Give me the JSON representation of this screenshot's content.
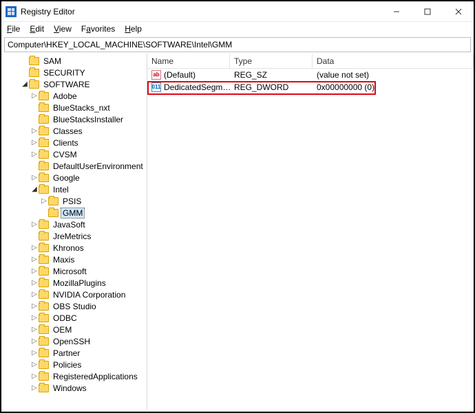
{
  "window": {
    "title": "Registry Editor"
  },
  "menu": {
    "file": "File",
    "edit": "Edit",
    "view": "View",
    "favorites": "Favorites",
    "help": "Help"
  },
  "path": "Computer\\HKEY_LOCAL_MACHINE\\SOFTWARE\\Intel\\GMM",
  "columns": {
    "name": "Name",
    "type": "Type",
    "data": "Data"
  },
  "values": [
    {
      "icon": "sz",
      "name": "(Default)",
      "type": "REG_SZ",
      "data": "(value not set)"
    },
    {
      "icon": "dw",
      "name": "DedicatedSegm…",
      "type": "REG_DWORD",
      "data": "0x00000000 (0)"
    }
  ],
  "tree": [
    {
      "indent": 2,
      "exp": "none",
      "label": "SAM"
    },
    {
      "indent": 2,
      "exp": "none",
      "label": "SECURITY"
    },
    {
      "indent": 2,
      "exp": "open",
      "label": "SOFTWARE"
    },
    {
      "indent": 3,
      "exp": "closed",
      "label": "Adobe"
    },
    {
      "indent": 3,
      "exp": "none",
      "label": "BlueStacks_nxt"
    },
    {
      "indent": 3,
      "exp": "none",
      "label": "BlueStacksInstaller"
    },
    {
      "indent": 3,
      "exp": "closed",
      "label": "Classes"
    },
    {
      "indent": 3,
      "exp": "closed",
      "label": "Clients"
    },
    {
      "indent": 3,
      "exp": "closed",
      "label": "CVSM"
    },
    {
      "indent": 3,
      "exp": "none",
      "label": "DefaultUserEnvironment"
    },
    {
      "indent": 3,
      "exp": "closed",
      "label": "Google"
    },
    {
      "indent": 3,
      "exp": "open",
      "label": "Intel"
    },
    {
      "indent": 4,
      "exp": "closed",
      "label": "PSIS"
    },
    {
      "indent": 4,
      "exp": "none",
      "label": "GMM",
      "selected": true
    },
    {
      "indent": 3,
      "exp": "closed",
      "label": "JavaSoft"
    },
    {
      "indent": 3,
      "exp": "none",
      "label": "JreMetrics"
    },
    {
      "indent": 3,
      "exp": "closed",
      "label": "Khronos"
    },
    {
      "indent": 3,
      "exp": "closed",
      "label": "Maxis"
    },
    {
      "indent": 3,
      "exp": "closed",
      "label": "Microsoft"
    },
    {
      "indent": 3,
      "exp": "closed",
      "label": "MozillaPlugins"
    },
    {
      "indent": 3,
      "exp": "closed",
      "label": "NVIDIA Corporation"
    },
    {
      "indent": 3,
      "exp": "closed",
      "label": "OBS Studio"
    },
    {
      "indent": 3,
      "exp": "closed",
      "label": "ODBC"
    },
    {
      "indent": 3,
      "exp": "closed",
      "label": "OEM"
    },
    {
      "indent": 3,
      "exp": "closed",
      "label": "OpenSSH"
    },
    {
      "indent": 3,
      "exp": "closed",
      "label": "Partner"
    },
    {
      "indent": 3,
      "exp": "closed",
      "label": "Policies"
    },
    {
      "indent": 3,
      "exp": "closed",
      "label": "RegisteredApplications"
    },
    {
      "indent": 3,
      "exp": "closed",
      "label": "Windows"
    }
  ],
  "icons": {
    "sz_text": "ab",
    "dw_text": "011"
  }
}
